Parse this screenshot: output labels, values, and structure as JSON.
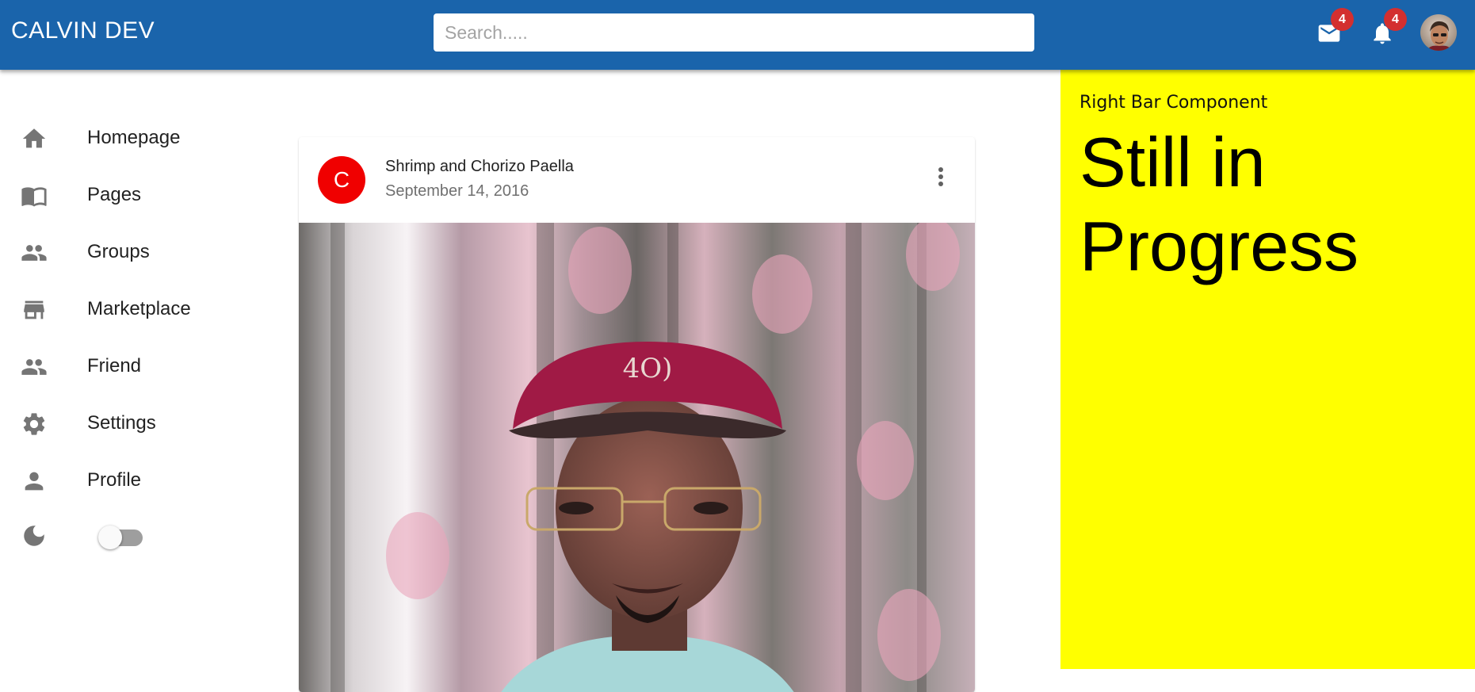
{
  "appbar": {
    "brand": "CALVIN DEV",
    "search_placeholder": "Search.....",
    "mail": {
      "icon": "mail-icon",
      "badge": "4"
    },
    "notifications": {
      "icon": "bell-icon",
      "badge": "4"
    },
    "avatar": "user-avatar",
    "color": "#1a64ab",
    "badge_color": "#d32f2f"
  },
  "sidebar": {
    "items": [
      {
        "label": "Homepage",
        "icon": "home-icon"
      },
      {
        "label": "Pages",
        "icon": "pages-icon"
      },
      {
        "label": "Groups",
        "icon": "groups-icon"
      },
      {
        "label": "Marketplace",
        "icon": "storefront-icon"
      },
      {
        "label": "Friend",
        "icon": "people-icon"
      },
      {
        "label": "Settings",
        "icon": "gear-icon"
      },
      {
        "label": "Profile",
        "icon": "person-icon"
      }
    ],
    "theme_toggle": {
      "icon": "moon-icon",
      "checked": false
    }
  },
  "post": {
    "avatar_letter": "C",
    "avatar_color": "#f00000",
    "title": "Shrimp and Chorizo Paella",
    "date": "September 14, 2016",
    "menu_icon": "more-vert-icon",
    "image": "post-photo"
  },
  "rightbar": {
    "caption": "Right Bar Component",
    "heading": "Still in Progress",
    "color": "#ffff00"
  }
}
